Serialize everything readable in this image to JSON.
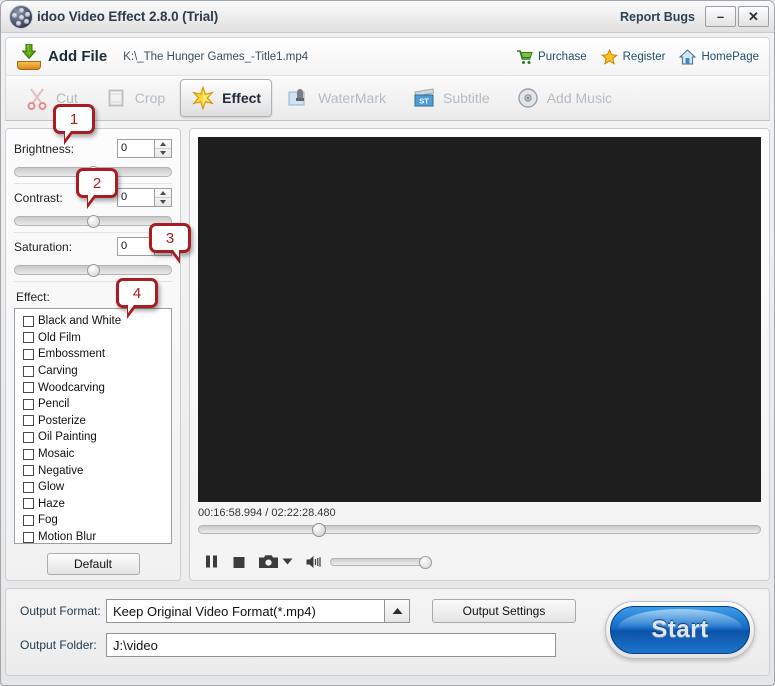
{
  "titlebar": {
    "app_title": "idoo Video Effect 2.8.0 (Trial)",
    "report_bugs": "Report Bugs",
    "minimize": "–",
    "close": "✕",
    "logo_icon": "film-reel-icon"
  },
  "addfile": {
    "button_label": "Add File",
    "button_icon": "download-arrow-icon",
    "file_path": "K:\\_The Hunger Games_-Title1.mp4",
    "links": [
      {
        "label": "Purchase",
        "icon": "shopping-cart-icon"
      },
      {
        "label": "Register",
        "icon": "star-icon"
      },
      {
        "label": "HomePage",
        "icon": "home-icon"
      }
    ]
  },
  "tabs": [
    {
      "label": "Cut",
      "icon": "scissors-icon",
      "active": false
    },
    {
      "label": "Crop",
      "icon": "crop-frame-icon",
      "active": false
    },
    {
      "label": "Effect",
      "icon": "sparkle-star-icon",
      "active": true
    },
    {
      "label": "WaterMark",
      "icon": "watermark-stamp-icon",
      "active": false
    },
    {
      "label": "Subtitle",
      "icon": "clapperboard-st-icon",
      "active": false
    },
    {
      "label": "Add Music",
      "icon": "music-disc-icon",
      "active": false
    }
  ],
  "adjustments": [
    {
      "label": "Brightness:",
      "value": "0",
      "knob_percent": 50
    },
    {
      "label": "Contrast:",
      "value": "0",
      "knob_percent": 50
    },
    {
      "label": "Saturation:",
      "value": "0",
      "knob_percent": 50
    }
  ],
  "effects": {
    "group_label": "Effect:",
    "items": [
      {
        "label": "Black and White",
        "checked": false
      },
      {
        "label": "Old Film",
        "checked": false
      },
      {
        "label": "Embossment",
        "checked": false
      },
      {
        "label": "Carving",
        "checked": false
      },
      {
        "label": "Woodcarving",
        "checked": false
      },
      {
        "label": "Pencil",
        "checked": false
      },
      {
        "label": "Posterize",
        "checked": false
      },
      {
        "label": "Oil Painting",
        "checked": false
      },
      {
        "label": "Mosaic",
        "checked": false
      },
      {
        "label": "Negative",
        "checked": false
      },
      {
        "label": "Glow",
        "checked": false
      },
      {
        "label": "Haze",
        "checked": false
      },
      {
        "label": "Fog",
        "checked": false
      },
      {
        "label": "Motion Blur",
        "checked": false
      }
    ],
    "default_button": "Default"
  },
  "preview": {
    "current_time": "00:16:58.994",
    "total_time": "02:22:28.480",
    "time_display": "00:16:58.994 / 02:22:28.480",
    "seek_percent": 21,
    "volume_percent": 100,
    "controls": [
      {
        "name": "pause-button",
        "icon": "pause-icon"
      },
      {
        "name": "stop-button",
        "icon": "stop-icon"
      },
      {
        "name": "snapshot-button",
        "icon": "camera-icon"
      },
      {
        "name": "snapshot-menu-button",
        "icon": "caret-down-icon"
      },
      {
        "name": "volume-button",
        "icon": "speaker-icon"
      }
    ]
  },
  "output": {
    "format_label": "Output Format:",
    "format_value": "Keep Original Video Format(*.mp4)",
    "format_dropdown_icon": "caret-up-icon",
    "settings_button": "Output Settings",
    "folder_label": "Output Folder:",
    "folder_value": "J:\\video",
    "folder_browse_icon": "folder-icon",
    "folder_search_icon": "magnifier-icon",
    "start_button": "Start"
  },
  "callouts": [
    {
      "number": "1"
    },
    {
      "number": "2"
    },
    {
      "number": "3"
    },
    {
      "number": "4"
    }
  ],
  "colors": {
    "callout_red": "#a81d21",
    "start_blue": "#1168c4",
    "video_black": "#1e1e1e",
    "link_text": "#20506e"
  }
}
